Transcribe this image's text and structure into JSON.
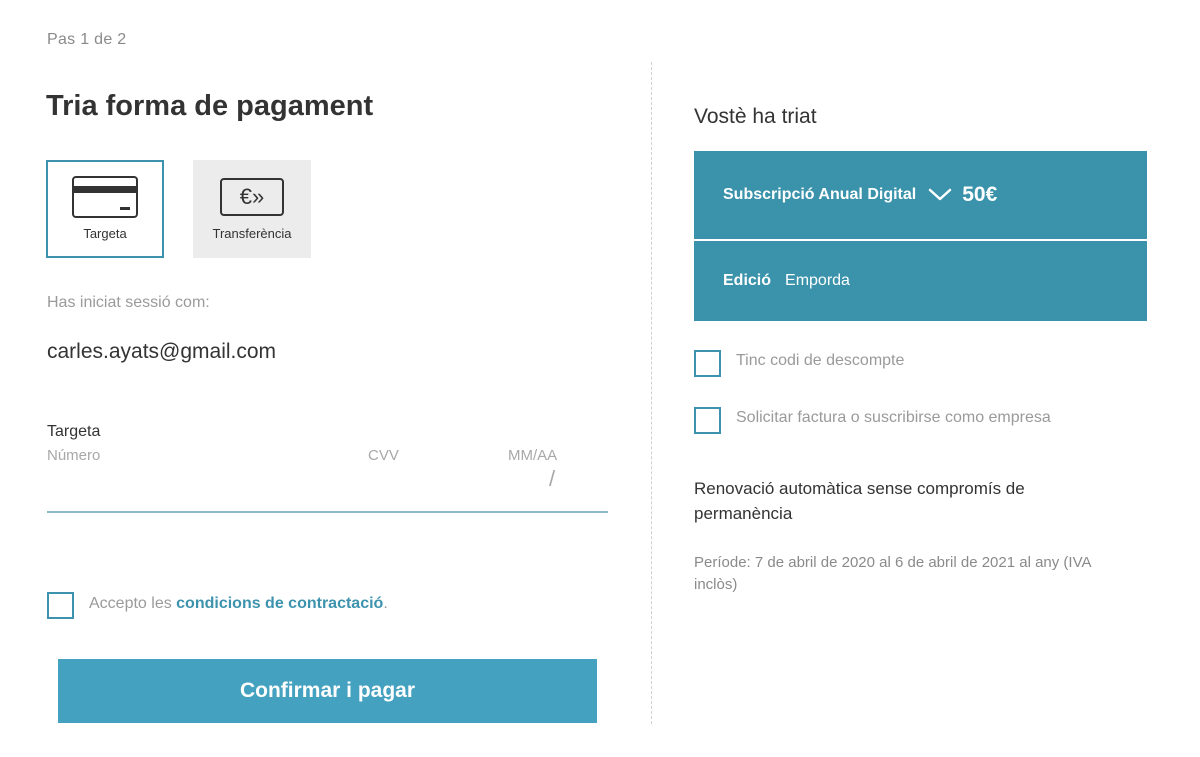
{
  "step": "Pas 1 de 2",
  "title": "Tria forma de pagament",
  "payment_methods": [
    {
      "label": "Targeta",
      "icon": "credit-card-icon",
      "selected": true
    },
    {
      "label": "Transferència",
      "icon": "euro-transfer-icon",
      "selected": false
    }
  ],
  "logged_in_label": "Has iniciat sessió com:",
  "email": "carles.ayats@gmail.com",
  "card_field": {
    "title": "Targeta",
    "number_placeholder": "Número",
    "cvv_placeholder": "CVV",
    "expiry_placeholder": "MM/AA",
    "expiry_separator": "/"
  },
  "accept": {
    "prefix": "Accepto les ",
    "link": "condicions de contractació",
    "suffix": "."
  },
  "confirm_label": "Confirmar i pagar",
  "summary": {
    "title": "Vostè ha triat",
    "plan_name": "Subscripció Anual Digital",
    "plan_price": "50€",
    "edition_label": "Edició",
    "edition_value": "Emporda",
    "discount_label": "Tinc codi de descompte",
    "invoice_label": "Solicitar factura o suscribirse como empresa",
    "renewal": "Renovació automàtica sense compromís de permanència",
    "period": "Període: 7 de abril de 2020 al 6 de abril de 2021 al any (IVA inclòs)"
  },
  "colors": {
    "accent": "#3a93ab",
    "button": "#44a1bf"
  }
}
